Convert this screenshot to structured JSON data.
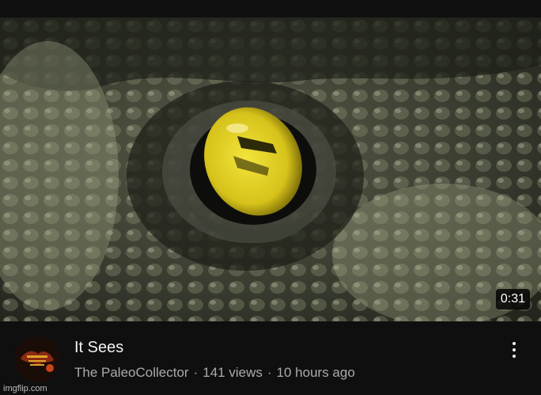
{
  "video": {
    "title": "It Sees",
    "channel": "The PaleoCollector",
    "views": "141 views",
    "age": "10 hours ago",
    "duration": "0:31",
    "separator": "·"
  },
  "icons": {
    "menu": "more-vert-icon"
  },
  "watermark": "imgflip.com",
  "colors": {
    "background": "#0f0f0f",
    "title_text": "#f1f1f1",
    "secondary_text": "#aaaaaa",
    "eye_yellow": "#d6c21a"
  }
}
